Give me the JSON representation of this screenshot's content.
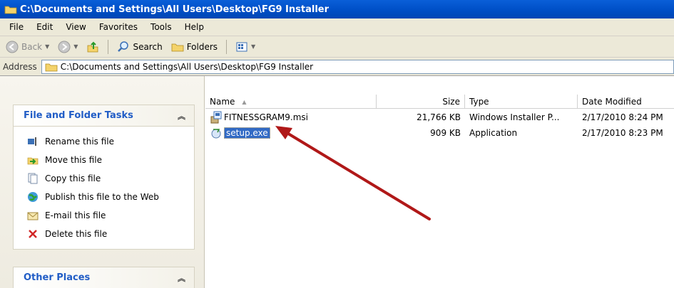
{
  "window": {
    "title": "C:\\Documents and Settings\\All Users\\Desktop\\FG9 Installer"
  },
  "menu": [
    {
      "label": "File"
    },
    {
      "label": "Edit"
    },
    {
      "label": "View"
    },
    {
      "label": "Favorites"
    },
    {
      "label": "Tools"
    },
    {
      "label": "Help"
    }
  ],
  "toolbar": {
    "back_label": "Back",
    "search_label": "Search",
    "folders_label": "Folders"
  },
  "address": {
    "label": "Address",
    "value": "C:\\Documents and Settings\\All Users\\Desktop\\FG9 Installer"
  },
  "tasks_panel": {
    "title": "File and Folder Tasks",
    "items": [
      {
        "label": "Rename this file",
        "icon": "rename-icon"
      },
      {
        "label": "Move this file",
        "icon": "move-icon"
      },
      {
        "label": "Copy this file",
        "icon": "copy-icon"
      },
      {
        "label": "Publish this file to the Web",
        "icon": "globe-icon"
      },
      {
        "label": "E-mail this file",
        "icon": "email-icon"
      },
      {
        "label": "Delete this file",
        "icon": "delete-icon"
      }
    ]
  },
  "other_places": {
    "title": "Other Places"
  },
  "columns": {
    "name": "Name",
    "size": "Size",
    "type": "Type",
    "date": "Date Modified"
  },
  "files": [
    {
      "name": "FITNESSGRAM9.msi",
      "size": "21,766 KB",
      "type": "Windows Installer P...",
      "date": "2/17/2010 8:24 PM",
      "selected": false
    },
    {
      "name": "setup.exe",
      "size": "909 KB",
      "type": "Application",
      "date": "2/17/2010 8:23 PM",
      "selected": true
    }
  ],
  "colors": {
    "title_bar": "#0050c8",
    "selection": "#316ac5",
    "annotation_arrow": "#b01818"
  }
}
